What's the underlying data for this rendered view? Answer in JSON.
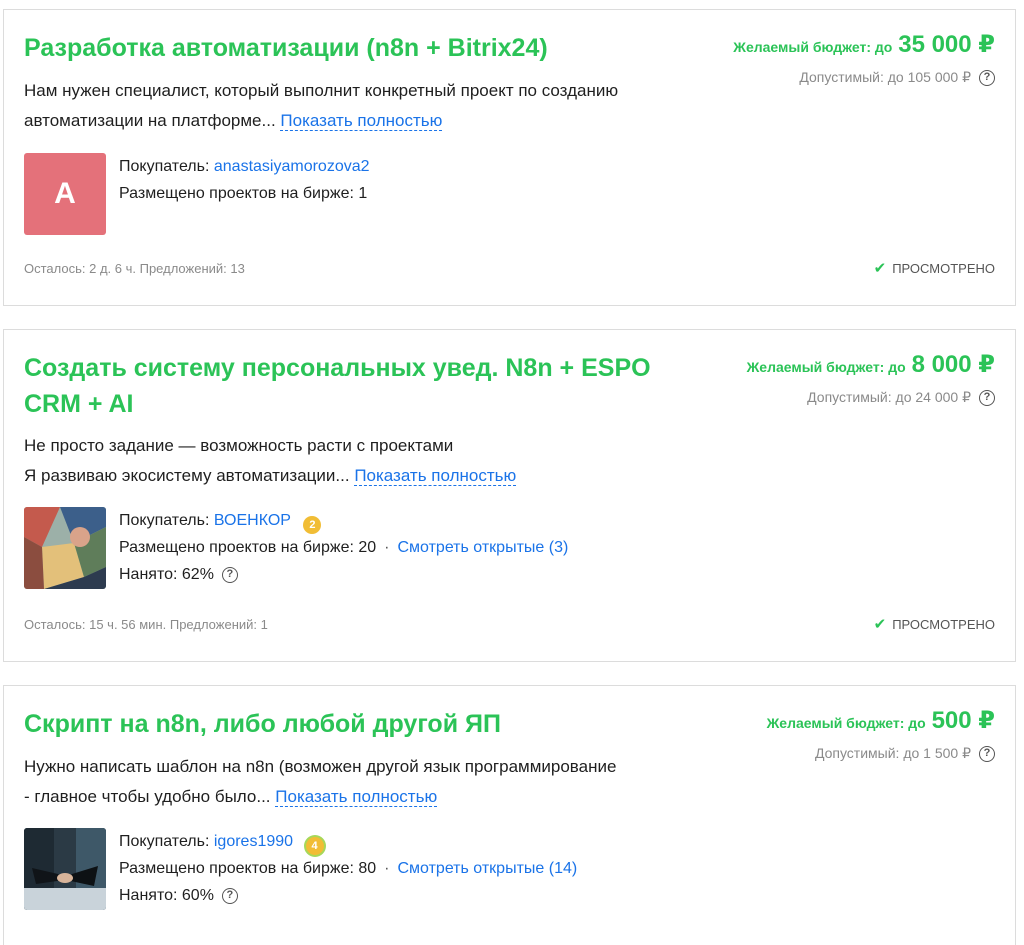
{
  "projects": [
    {
      "title": "Разработка автоматизации (n8n + Bitrix24)",
      "budget_label": "Желаемый бюджет: до",
      "budget_amount": "35 000 ₽",
      "allowed": "Допустимый: до 105 000 ₽",
      "desc_lines": [
        "Нам нужен специалист, который выполнит конкретный проект по созданию",
        "автоматизации на платформе..."
      ],
      "more_label": "Показать полностью",
      "avatar_letter": "A",
      "buyer_label": "Покупатель:",
      "buyer_name": "anastasiyamorozova2",
      "placed_label": "Размещено проектов на бирже: 1",
      "footer_left": "Осталось: 2 д. 6 ч.  Предложений: 13",
      "viewed_label": "ПРОСМОТРЕНО"
    },
    {
      "title": "Создать систему персональных увед. N8n + ESPO CRM + AI",
      "budget_label": "Желаемый бюджет: до",
      "budget_amount": "8 000 ₽",
      "allowed": "Допустимый: до 24 000 ₽",
      "desc_lines": [
        "Не просто задание — возможность расти с проектами",
        "Я развиваю экосистему автоматизации..."
      ],
      "more_label": "Показать полностью",
      "buyer_label": "Покупатель:",
      "buyer_name": "ВОЕНКОР",
      "badge": "2",
      "placed_label": "Размещено проектов на бирже: 20",
      "open_link": "Смотреть открытые (3)",
      "hired_label": "Нанято: 62%",
      "footer_left": "Осталось: 15 ч. 56 мин.  Предложений: 1",
      "viewed_label": "ПРОСМОТРЕНО"
    },
    {
      "title": "Скрипт на n8n, либо любой другой ЯП",
      "budget_label": "Желаемый бюджет: до",
      "budget_amount": "500 ₽",
      "allowed": "Допустимый: до 1 500 ₽",
      "desc_lines": [
        "Нужно написать шаблон на n8n (возможен другой язык программирование",
        "- главное чтобы удобно было..."
      ],
      "more_label": "Показать полностью",
      "buyer_label": "Покупатель:",
      "buyer_name": "igores1990",
      "badge": "4",
      "placed_label": "Размещено проектов на бирже: 80",
      "open_link": "Смотреть открытые (14)",
      "hired_label": "Нанято: 60%"
    }
  ],
  "colors": {
    "accent_green": "#2bc357",
    "link_blue": "#1a73e8",
    "avatar_red": "#e4717a",
    "muted": "#8a8a8a"
  },
  "icons": {
    "help": "question-circle-icon",
    "viewed": "checkmark-icon",
    "rank": "rank-badge-icon"
  }
}
